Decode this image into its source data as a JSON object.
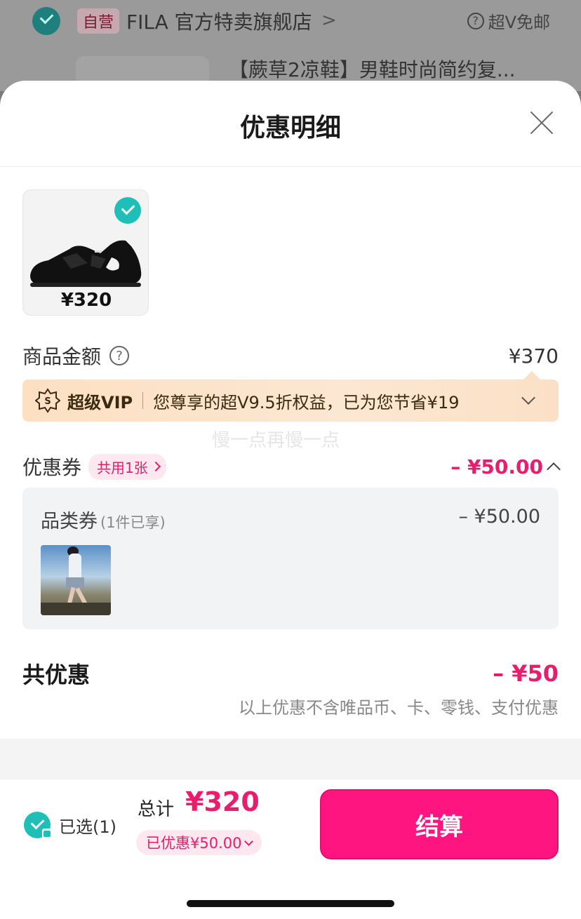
{
  "background": {
    "tag": "自营",
    "store_name": "FILA 官方特卖旗舰店",
    "vip_free_shipping": "超V免邮",
    "product_title": "【蕨草2凉鞋】男鞋时尚简约复..."
  },
  "sheet": {
    "title": "优惠明细",
    "product": {
      "price": "¥320",
      "selected": true
    },
    "amount_row": {
      "label": "商品金额",
      "value": "¥370"
    },
    "vip_banner": {
      "name": "超级VIP",
      "text": "您尊享的超V9.5折权益，已为您节省¥19"
    },
    "watermark": "慢一点再慢一点",
    "coupon_row": {
      "label": "优惠券",
      "pill": "共用1张",
      "value": "– ¥50.00"
    },
    "coupon_detail": {
      "title": "品类券",
      "subtitle": "(1件已享)",
      "value": "– ¥50.00"
    },
    "total_discount": {
      "label": "共优惠",
      "value": "– ¥50",
      "note": "以上优惠不含唯品币、卡、零钱、支付优惠"
    }
  },
  "bottom_bar": {
    "selected_text": "已选(1)",
    "total_label": "总计",
    "total_price": "¥320",
    "saved_text": "已优惠¥50.00",
    "checkout_label": "结算"
  },
  "colors": {
    "accent_pink": "#e81d6b",
    "checkout_pink": "#ff1580",
    "check_teal": "#1fbfb8",
    "vip_banner": "#fde0c2"
  }
}
